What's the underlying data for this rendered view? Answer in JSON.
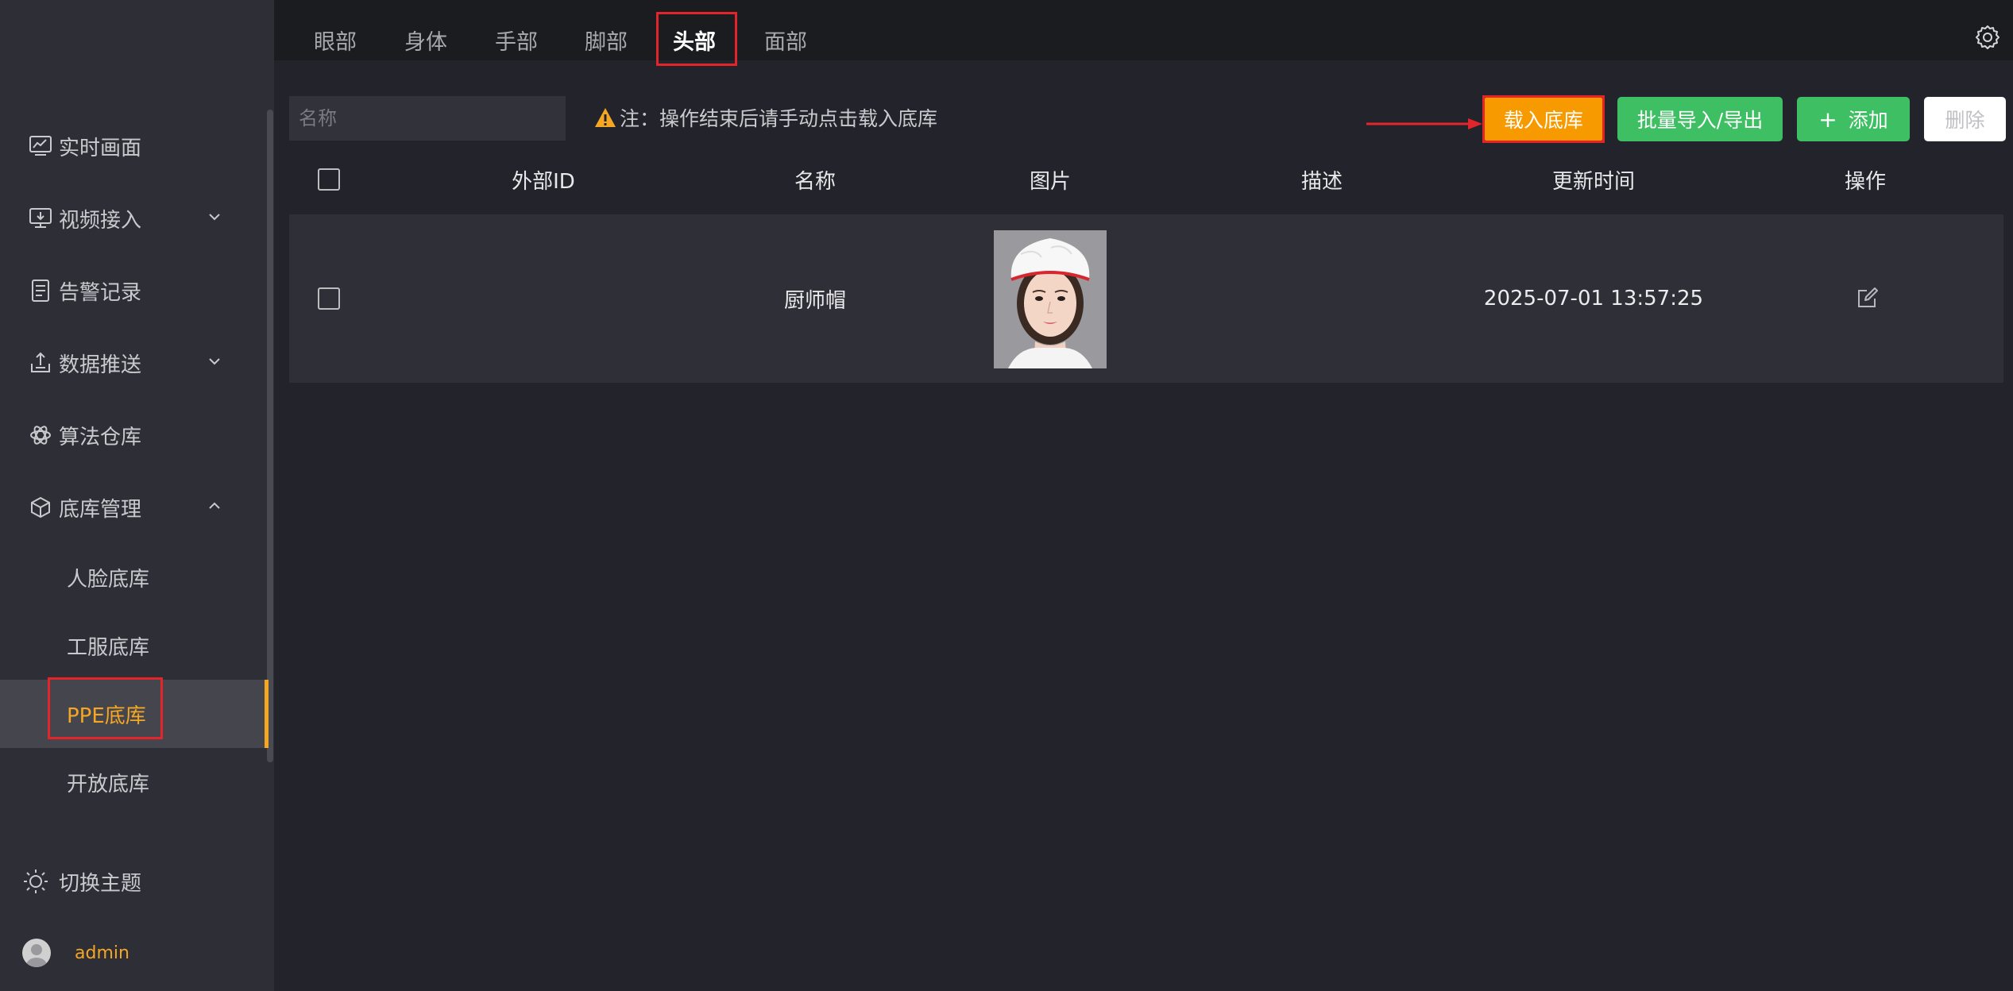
{
  "sidebar": {
    "items": [
      {
        "label": "实时画面",
        "icon": "monitor-chart-icon"
      },
      {
        "label": "视频接入",
        "icon": "video-screen-icon"
      },
      {
        "label": "告警记录",
        "icon": "document-list-icon"
      },
      {
        "label": "数据推送",
        "icon": "upload-tray-icon"
      },
      {
        "label": "算法仓库",
        "icon": "atom-icon"
      },
      {
        "label": "底库管理",
        "icon": "cube-icon"
      }
    ],
    "sub_items": [
      {
        "label": "人脸底库"
      },
      {
        "label": "工服底库"
      },
      {
        "label": "PPE底库"
      },
      {
        "label": "开放底库"
      }
    ],
    "theme_label": "切换主题",
    "user": "admin"
  },
  "tabs": [
    {
      "label": "眼部"
    },
    {
      "label": "身体"
    },
    {
      "label": "手部"
    },
    {
      "label": "脚部"
    },
    {
      "label": "头部"
    },
    {
      "label": "面部"
    }
  ],
  "toolbar": {
    "search_placeholder": "名称",
    "note": "注：操作结束后请手动点击载入底库",
    "load_label": "载入底库",
    "batch_label": "批量导入/导出",
    "add_label": "添加",
    "add_icon": "+",
    "delete_label": "删除"
  },
  "table": {
    "headers": [
      "外部ID",
      "名称",
      "图片",
      "描述",
      "更新时间",
      "操作"
    ],
    "rows": [
      {
        "external_id": "",
        "name": "厨师帽",
        "description": "",
        "updated": "2025-07-01 13:57:25"
      }
    ]
  },
  "colors": {
    "accent": "#f5a623",
    "load_button": "#f79a00",
    "green_button": "#3fbf63",
    "highlight_box": "#e3242b"
  }
}
